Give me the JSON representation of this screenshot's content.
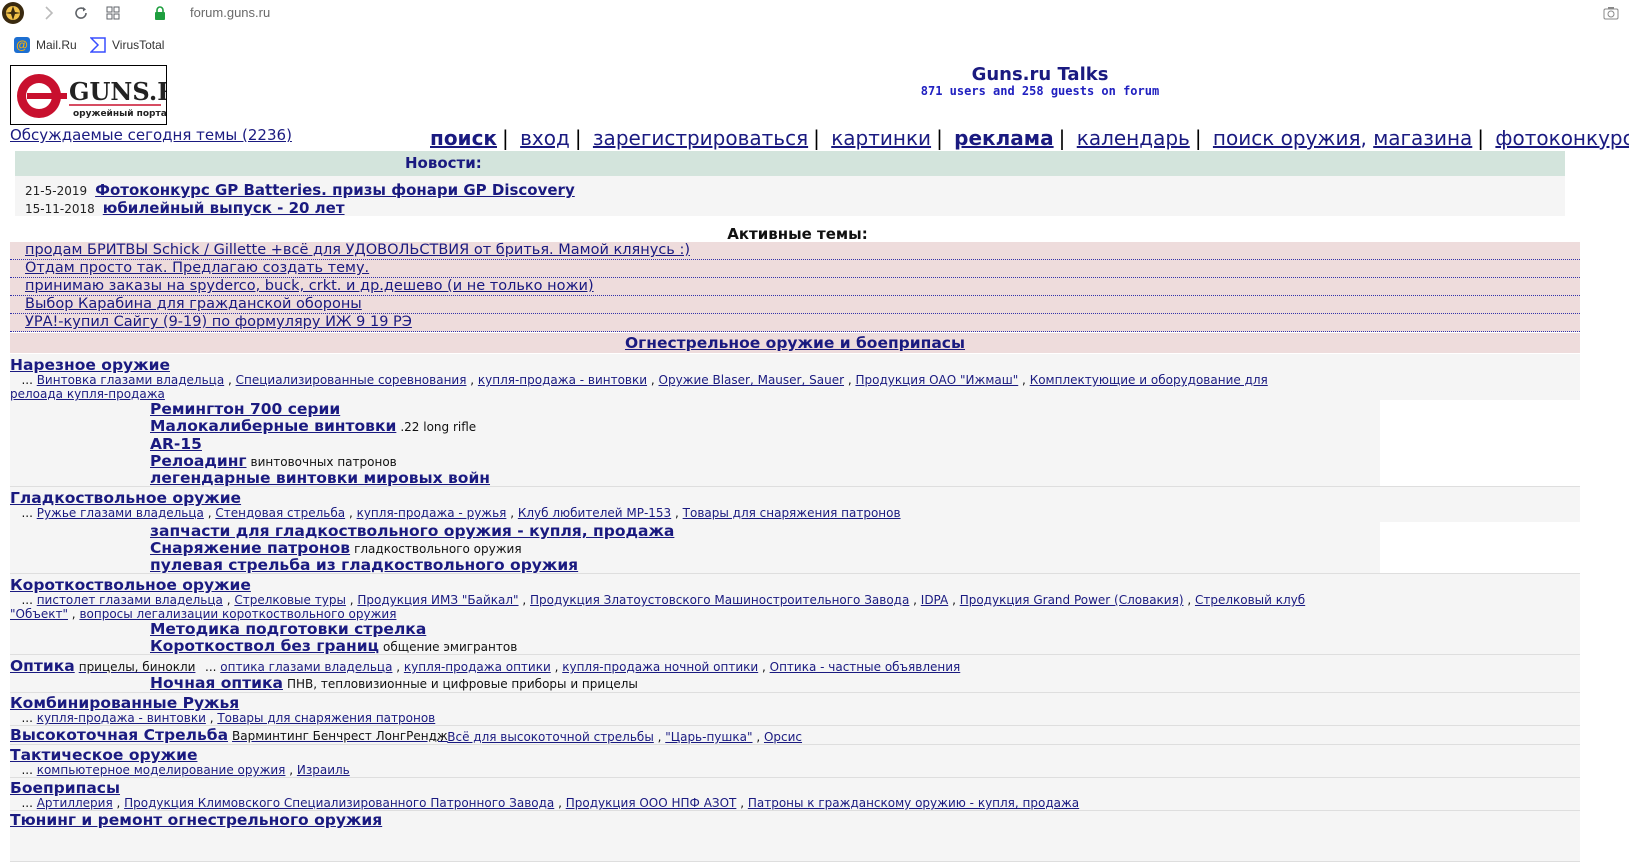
{
  "browser": {
    "url": "forum.guns.ru",
    "bookmarks": [
      {
        "label": "Mail.Ru",
        "icon": "mailru-icon"
      },
      {
        "label": "VirusTotal",
        "icon": "virustotal-icon"
      }
    ]
  },
  "header": {
    "logo_text": "GUNS.RU",
    "logo_sub": "оружейный портал",
    "title": "Guns.ru Talks",
    "subtitle": "871 users and 258 guests on forum",
    "today_topics": "Обсуждаемые сегодня темы (2236)"
  },
  "nav": [
    "поиск",
    "вход",
    "зарегистрироваться",
    "картинки",
    "реклама",
    "календарь",
    "поиск оружия",
    "магазина",
    "фотоконкурсы"
  ],
  "news": {
    "heading": "Новости:",
    "items": [
      {
        "date": "21-5-2019",
        "title": "Фотоконкурс GP Batteries. призы фонари GP Discovery"
      },
      {
        "date": "15-11-2018",
        "title": "юбилейный выпуск - 20 лет"
      }
    ]
  },
  "active": {
    "heading": "Активные темы:",
    "topics": [
      "продам БРИТВЫ Schick / Gillette +всё для УДОВОЛЬСТВИЯ от бритья. Мамой клянусь :)",
      "Отдам просто так. Предлагаю создать тему.",
      "принимаю заказы на spyderco, buck, crkt. и др.дешево (и не только ножи)",
      "Выбор Карабина для гражданской обороны",
      "УРА!-купил Сайгу (9-19) по формуляру ИЖ 9 19 РЭ"
    ]
  },
  "category": "Огнестрельное оружие и боеприпасы",
  "sections": [
    {
      "title": "Нарезное оружие",
      "note": "",
      "links": [
        "Винтовка глазами владельца",
        "Специализированные соревнования",
        "купля-продажа - винтовки",
        "Оружие Blaser, Mauser, Sauer",
        "Продукция ОАО \"Ижмаш\"",
        "Комплектующие и оборудование для релоада купля-продажа"
      ],
      "subs": [
        {
          "name": "Ремингтон 700 серии",
          "desc": ""
        },
        {
          "name": "Малокалиберные винтовки",
          "desc": ".22 long rifle"
        },
        {
          "name": "AR-15",
          "desc": ""
        },
        {
          "name": "Релоадинг",
          "desc": "винтовочных патронов"
        },
        {
          "name": "легендарные винтовки мировых войн",
          "desc": ""
        }
      ]
    },
    {
      "title": "Гладкоствольное оружие",
      "note": "",
      "links": [
        "Ружье глазами владельца",
        "Стендовая стрельба",
        "купля-продажа - ружья",
        "Клуб любителей МР-153",
        "Товары для снаряжения патронов"
      ],
      "subs": [
        {
          "name": "запчасти для гладкоствольного оружия - купля, продажа",
          "desc": ""
        },
        {
          "name": "Снаряжение патронов",
          "desc": "гладкоствольного оружия"
        },
        {
          "name": "пулевая стрельба из гладкоствольного оружия",
          "desc": ""
        }
      ]
    },
    {
      "title": "Короткоствольное оружие",
      "note": "",
      "links": [
        "пистолет глазами владельца",
        "Стрелковые туры",
        "Продукция ИМЗ \"Байкал\"",
        "Продукция Златоустовского Машиностроительного Завода",
        "IDPA",
        "Продукция Grand Power (Словакия)",
        "Стрелковый клуб \"Объект\"",
        "вопросы легализации короткоствольного оружия"
      ],
      "subs": [
        {
          "name": "Методика подготовки стрелка",
          "desc": ""
        },
        {
          "name": "Короткоствол без границ",
          "desc": "общение эмигрантов"
        }
      ]
    },
    {
      "title": "Оптика",
      "note": "прицелы, бинокли",
      "links": [
        "оптика глазами владельца",
        "купля-продажа оптики",
        "купля-продажа ночной оптики",
        "Оптика - частные объявления"
      ],
      "subs": [
        {
          "name": "Ночная оптика",
          "desc": "ПНВ, тепловизионные и цифровые приборы и прицелы"
        }
      ]
    },
    {
      "title": "Комбинированные Ружья",
      "note": "",
      "links": [
        "купля-продажа - винтовки",
        "Товары для снаряжения патронов"
      ],
      "subs": []
    },
    {
      "title": "Высокоточная Стрельба",
      "note": "Варминтинг Бенчрест ЛонгРендж",
      "links": [
        "Всё для высокоточной стрельбы",
        "\"Царь-пушка\"",
        "Орсис"
      ],
      "subs": []
    },
    {
      "title": "Тактическое оружие",
      "note": "",
      "links": [
        "компьютерное моделирование оружия",
        "Израиль"
      ],
      "subs": []
    },
    {
      "title": "Боеприпасы",
      "note": "",
      "links": [
        "Артиллерия",
        "Продукция Климовского Специализированного Патронного Завода",
        "Продукция ООО НПФ АЗОТ",
        "Патроны к гражданскому оружию - купля, продажа"
      ],
      "subs": []
    },
    {
      "title": "Тюнинг и ремонт огнестрельного оружия",
      "note": "",
      "links": [],
      "subs": []
    }
  ]
}
